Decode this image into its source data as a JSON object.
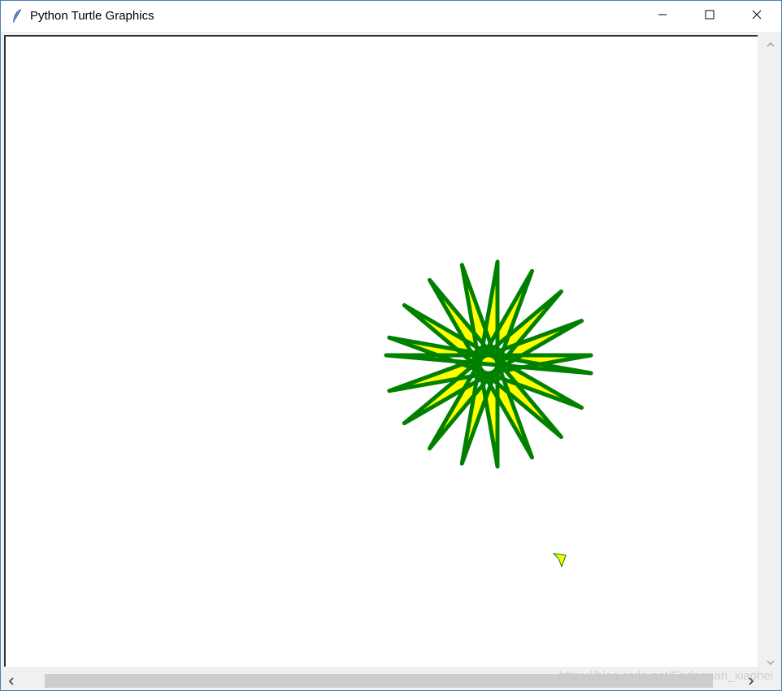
{
  "window": {
    "title": "Python Turtle Graphics",
    "app_icon": "feather-icon",
    "controls": {
      "minimize_icon": "minimize-icon",
      "maximize_icon": "maximize-icon",
      "close_icon": "close-icon"
    }
  },
  "canvas": {
    "background": "#ffffff",
    "drawing": {
      "shape": "star",
      "points": 18,
      "pen_color": "#008000",
      "fill_color": "#ffff00"
    },
    "turtle": {
      "icon": "turtle-arrow-icon",
      "fill_color": "#ffff00",
      "pen_color": "#008000"
    }
  },
  "scrollbars": {
    "vertical": {
      "up_icon": "chevron-up-icon",
      "down_icon": "chevron-down-icon"
    },
    "horizontal": {
      "left_icon": "chevron-left-icon",
      "right_icon": "chevron-right-icon"
    }
  },
  "watermark": "https://blog.csdn.net/Enderman_xiaohei"
}
